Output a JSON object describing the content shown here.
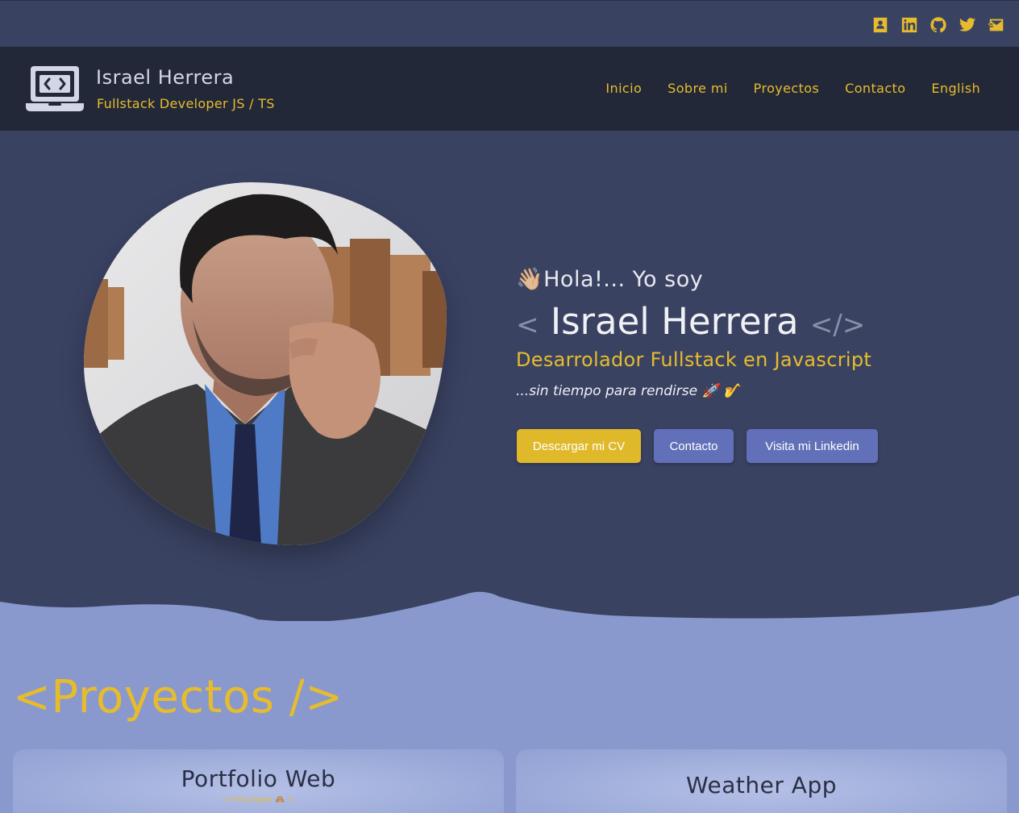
{
  "social": {
    "icons": [
      "contact-card-icon",
      "linkedin-icon",
      "github-icon",
      "twitter-icon",
      "mail-icon"
    ]
  },
  "header": {
    "brand_name": "Israel Herrera",
    "brand_subtitle": "Fullstack Developer JS / TS",
    "nav": [
      "Inicio",
      "Sobre mi",
      "Proyectos",
      "Contacto",
      "English"
    ]
  },
  "hero": {
    "greeting": "👋🏼Hola!... Yo soy",
    "open_tag": "<",
    "name": "Israel Herrera",
    "close_tag": "</>",
    "role": "Desarrolador Fullstack en Javascript",
    "motto": "...sin tiempo para rendirse 🚀 🎷",
    "buttons": {
      "cv": "Descargar mi CV",
      "contact": "Contacto",
      "linkedin": "Visita mi Linkedin"
    }
  },
  "projects": {
    "title": "<Proyectos />",
    "cards": [
      {
        "title": "Portfolio Web",
        "note": "-> this project 🙈 <-"
      },
      {
        "title": "Weather App"
      }
    ]
  },
  "colors": {
    "accent": "#e6bc2d",
    "background": "#3a4262",
    "header": "#232838",
    "button_secondary": "#6170b8",
    "projects_bg": "#8999cd"
  }
}
